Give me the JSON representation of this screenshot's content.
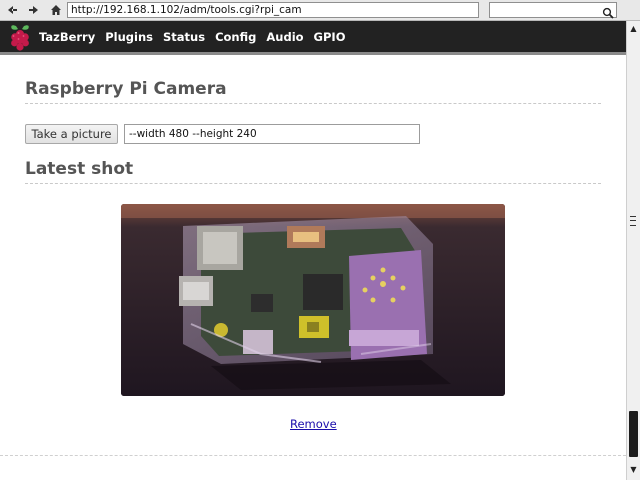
{
  "browser": {
    "url": "http://192.168.1.102/adm/tools.cgi?rpi_cam",
    "search_value": ""
  },
  "header": {
    "nav": [
      "TazBerry",
      "Plugins",
      "Status",
      "Config",
      "Audio",
      "GPIO"
    ]
  },
  "page": {
    "title": "Raspberry Pi Camera",
    "take_picture_label": "Take a picture",
    "options_value": "--width 480 --height 240",
    "latest_heading": "Latest shot",
    "remove_label": "Remove"
  },
  "icons": {
    "back": "arrow-left-icon",
    "forward": "arrow-right-icon",
    "home": "home-icon",
    "search": "magnifier-icon",
    "logo": "raspberry-pi-logo"
  },
  "colors": {
    "header_bg": "#222222",
    "heading": "#555555",
    "link": "#1a0dab"
  }
}
